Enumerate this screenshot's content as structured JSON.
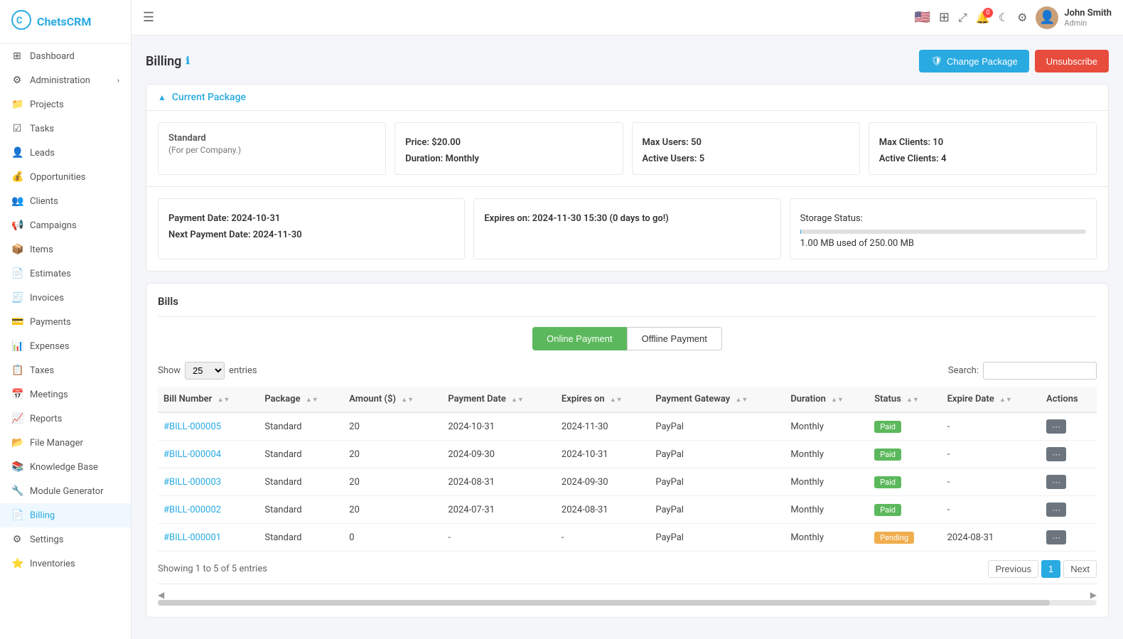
{
  "app": {
    "name": "ChetsCRM",
    "logo_icon": "⚙"
  },
  "topbar": {
    "hamburger": "☰",
    "flag": "🇺🇸",
    "grid_icon": "⊞",
    "expand_icon": "⤢",
    "notification_icon": "🔔",
    "notification_count": "0",
    "moon_icon": "☾",
    "settings_icon": "⚙",
    "user_name": "John Smith",
    "user_role": "Admin",
    "avatar": "👤"
  },
  "sidebar": {
    "items": [
      {
        "id": "dashboard",
        "label": "Dashboard",
        "icon": "⊞"
      },
      {
        "id": "administration",
        "label": "Administration",
        "icon": "⚙",
        "has_chevron": true
      },
      {
        "id": "projects",
        "label": "Projects",
        "icon": "📁"
      },
      {
        "id": "tasks",
        "label": "Tasks",
        "icon": "☑"
      },
      {
        "id": "leads",
        "label": "Leads",
        "icon": "👤"
      },
      {
        "id": "opportunities",
        "label": "Opportunities",
        "icon": "💰"
      },
      {
        "id": "clients",
        "label": "Clients",
        "icon": "👥"
      },
      {
        "id": "campaigns",
        "label": "Campaigns",
        "icon": "📢"
      },
      {
        "id": "items",
        "label": "Items",
        "icon": "📦"
      },
      {
        "id": "estimates",
        "label": "Estimates",
        "icon": "📄"
      },
      {
        "id": "invoices",
        "label": "Invoices",
        "icon": "🧾"
      },
      {
        "id": "payments",
        "label": "Payments",
        "icon": "💳"
      },
      {
        "id": "expenses",
        "label": "Expenses",
        "icon": "📊"
      },
      {
        "id": "taxes",
        "label": "Taxes",
        "icon": "📋"
      },
      {
        "id": "meetings",
        "label": "Meetings",
        "icon": "📅"
      },
      {
        "id": "reports",
        "label": "Reports",
        "icon": "📈"
      },
      {
        "id": "file-manager",
        "label": "File Manager",
        "icon": "📂"
      },
      {
        "id": "knowledge-base",
        "label": "Knowledge Base",
        "icon": "📚"
      },
      {
        "id": "module-generator",
        "label": "Module Generator",
        "icon": "🔧"
      },
      {
        "id": "billing",
        "label": "Billing",
        "icon": "📄",
        "active": true
      },
      {
        "id": "settings",
        "label": "Settings",
        "icon": "⚙"
      },
      {
        "id": "inventories",
        "label": "Inventories",
        "icon": "⭐"
      }
    ]
  },
  "page": {
    "title": "Billing",
    "info_icon": "ℹ",
    "change_package_label": "Change Package",
    "unsubscribe_label": "Unsubscribe"
  },
  "current_package": {
    "section_title": "Current Package",
    "card1": {
      "title": "Standard",
      "subtitle": "(For per Company.)"
    },
    "card2": {
      "price_label": "Price:",
      "price_value": "$20.00",
      "duration_label": "Duration:",
      "duration_value": "Monthly"
    },
    "card3": {
      "max_users_label": "Max Users:",
      "max_users_value": "50",
      "active_users_label": "Active Users:",
      "active_users_value": "5"
    },
    "card4": {
      "max_clients_label": "Max Clients:",
      "max_clients_value": "10",
      "active_clients_label": "Active Clients:",
      "active_clients_value": "4"
    },
    "card5": {
      "payment_date_label": "Payment Date:",
      "payment_date_value": "2024-10-31",
      "next_payment_label": "Next Payment Date:",
      "next_payment_value": "2024-11-30"
    },
    "card6": {
      "expires_label": "Expires on:",
      "expires_value": "2024-11-30 15:30 (0 days to go!)"
    },
    "card7": {
      "storage_label": "Storage Status:",
      "storage_used": "1.00 MB used of 250.00 MB",
      "storage_percent": 0.4
    }
  },
  "bills": {
    "title": "Bills",
    "online_payment_label": "Online Payment",
    "offline_payment_label": "Offline Payment",
    "show_label": "Show",
    "show_value": "25",
    "entries_label": "entries",
    "search_label": "Search:",
    "search_placeholder": "",
    "columns": [
      {
        "key": "bill_number",
        "label": "Bill Number"
      },
      {
        "key": "package",
        "label": "Package"
      },
      {
        "key": "amount",
        "label": "Amount ($)"
      },
      {
        "key": "payment_date",
        "label": "Payment Date"
      },
      {
        "key": "expires_on",
        "label": "Expires on"
      },
      {
        "key": "payment_gateway",
        "label": "Payment Gateway"
      },
      {
        "key": "duration",
        "label": "Duration"
      },
      {
        "key": "status",
        "label": "Status"
      },
      {
        "key": "expire_date",
        "label": "Expire Date"
      },
      {
        "key": "actions",
        "label": "Actions"
      }
    ],
    "rows": [
      {
        "bill_number": "#BILL-000005",
        "package": "Standard",
        "amount": "20",
        "payment_date": "2024-10-31",
        "expires_on": "2024-11-30",
        "payment_gateway": "PayPal",
        "duration": "Monthly",
        "status": "Paid",
        "expire_date": "-"
      },
      {
        "bill_number": "#BILL-000004",
        "package": "Standard",
        "amount": "20",
        "payment_date": "2024-09-30",
        "expires_on": "2024-10-31",
        "payment_gateway": "PayPal",
        "duration": "Monthly",
        "status": "Paid",
        "expire_date": "-"
      },
      {
        "bill_number": "#BILL-000003",
        "package": "Standard",
        "amount": "20",
        "payment_date": "2024-08-31",
        "expires_on": "2024-09-30",
        "payment_gateway": "PayPal",
        "duration": "Monthly",
        "status": "Paid",
        "expire_date": "-"
      },
      {
        "bill_number": "#BILL-000002",
        "package": "Standard",
        "amount": "20",
        "payment_date": "2024-07-31",
        "expires_on": "2024-08-31",
        "payment_gateway": "PayPal",
        "duration": "Monthly",
        "status": "Paid",
        "expire_date": "-"
      },
      {
        "bill_number": "#BILL-000001",
        "package": "Standard",
        "amount": "0",
        "payment_date": "-",
        "expires_on": "-",
        "payment_gateway": "PayPal",
        "duration": "Monthly",
        "status": "Pending",
        "expire_date": "2024-08-31"
      }
    ],
    "showing_text": "Showing 1 to 5 of 5 entries",
    "prev_label": "Previous",
    "next_label": "Next",
    "current_page": "1"
  }
}
